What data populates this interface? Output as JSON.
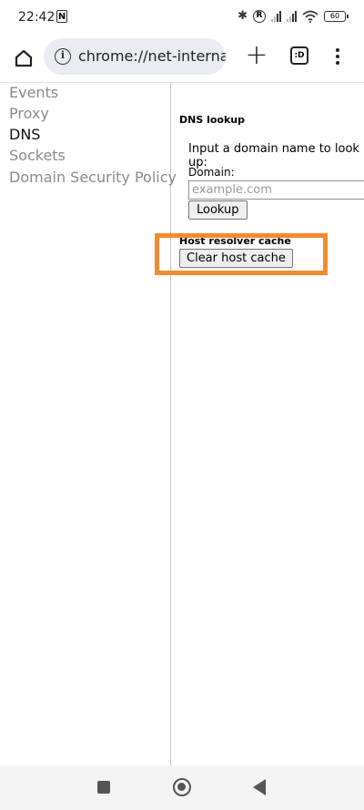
{
  "status_bar": {
    "time": "22:42",
    "n_badge": "N",
    "bluetooth": "✱",
    "registered": "R",
    "battery": "60"
  },
  "toolbar": {
    "url": "chrome://net-internals",
    "tab_count": ":D",
    "plus": "+"
  },
  "sidebar": {
    "items": [
      {
        "label": "Events"
      },
      {
        "label": "Proxy"
      },
      {
        "label": "DNS"
      },
      {
        "label": "Sockets"
      },
      {
        "label": "Domain Security Policy"
      }
    ]
  },
  "dns": {
    "heading": "DNS lookup",
    "prompt": "Input a domain name to look up:",
    "domain_label": "Domain:",
    "domain_placeholder": "example.com",
    "domain_value": "",
    "lookup_button": "Lookup",
    "cache_heading": "Host resolver cache",
    "clear_button": "Clear host cache"
  },
  "colors": {
    "highlight": "#f28a30",
    "omnibox_bg": "#e9edf2"
  }
}
